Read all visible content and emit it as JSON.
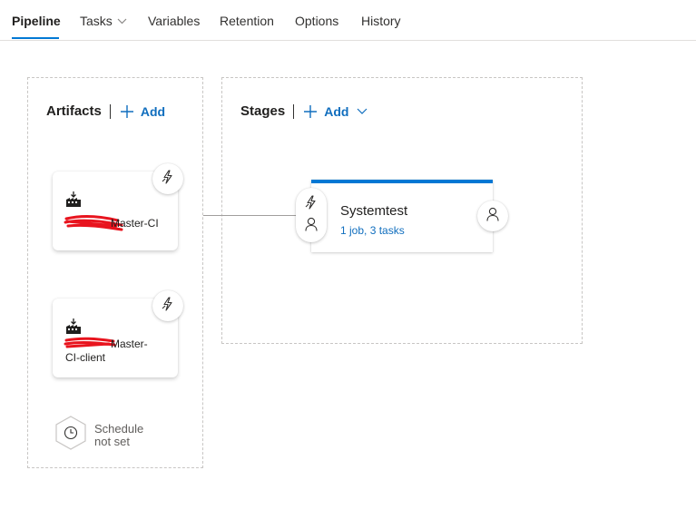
{
  "tabs": [
    {
      "label": "Pipeline",
      "active": true
    },
    {
      "label": "Tasks",
      "has_dropdown": true
    },
    {
      "label": "Variables"
    },
    {
      "label": "Retention"
    },
    {
      "label": "Options"
    },
    {
      "label": "History"
    }
  ],
  "artifacts": {
    "title": "Artifacts",
    "add_label": "Add",
    "items": [
      {
        "name_line1": "Master-CI",
        "icon": "build-artifact-icon",
        "trigger_icon": "lightning-icon"
      },
      {
        "name_line1": "Master-",
        "name_line2": "CI-client",
        "icon": "build-artifact-icon",
        "trigger_icon": "lightning-icon"
      }
    ],
    "schedule": {
      "line1": "Schedule",
      "line2": "not set",
      "icon": "clock-icon"
    }
  },
  "stages": {
    "title": "Stages",
    "add_label": "Add",
    "items": [
      {
        "name": "Systemtest",
        "summary": "1 job, 3 tasks"
      }
    ]
  },
  "colors": {
    "accent": "#0078d4",
    "link": "#106ebe",
    "redaction": "#e8141e"
  }
}
